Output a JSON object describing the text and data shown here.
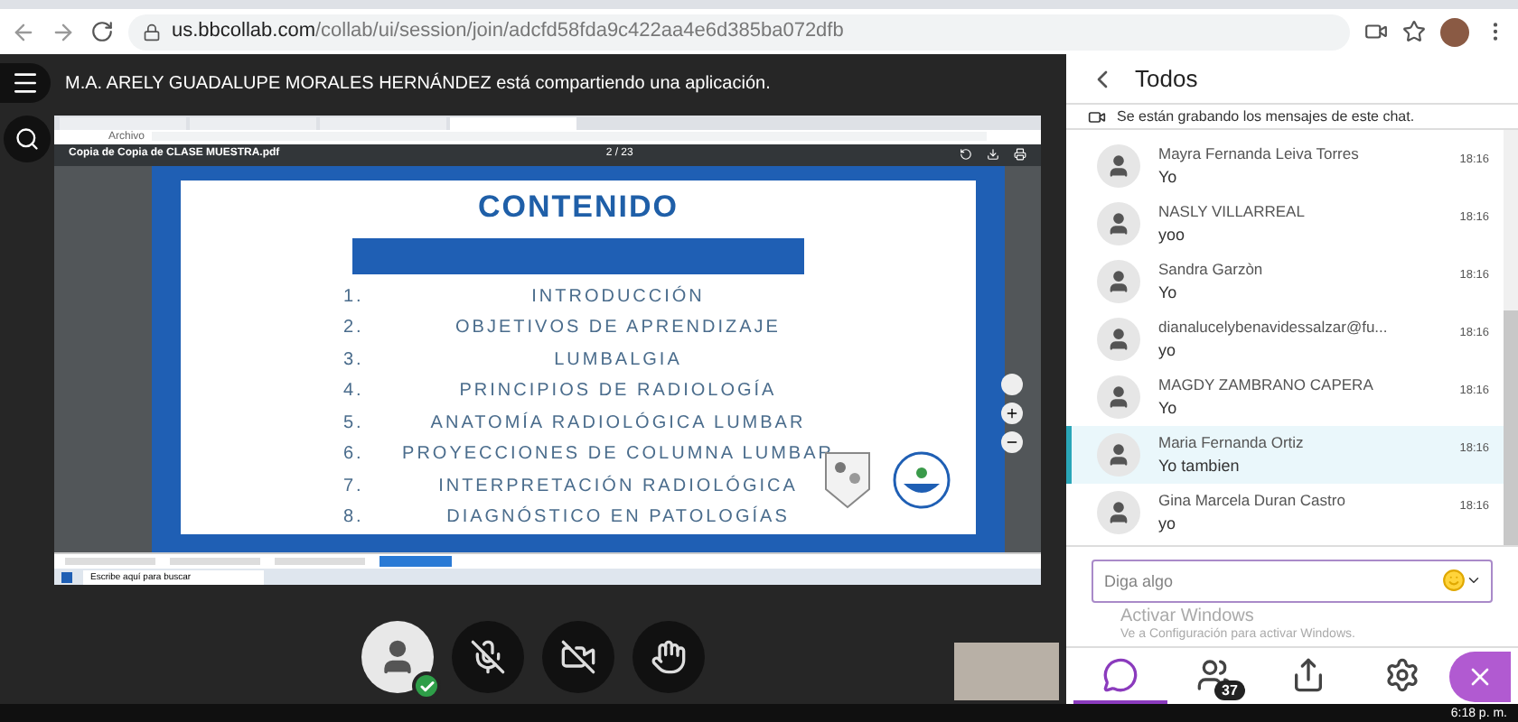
{
  "browser": {
    "url_host": "us.bbcollab.com",
    "url_path": "/collab/ui/session/join/adcfd58fda9c422aa4e6d385ba072dfb"
  },
  "share_banner": "M.A. ARELY GUADALUPE MORALES HERNÁNDEZ está compartiendo una aplicación.",
  "shared_screen": {
    "address_label": "Archivo",
    "pdf_title": "Copia de Copia de CLASE MUESTRA.pdf",
    "page_indicator": "2 / 23",
    "slide": {
      "title": "CONTENIDO",
      "items": [
        {
          "number": "1.",
          "label": "INTRODUCCIÓN"
        },
        {
          "number": "2.",
          "label": "OBJETIVOS DE APRENDIZAJE"
        },
        {
          "number": "3.",
          "label": "LUMBALGIA"
        },
        {
          "number": "4.",
          "label": "PRINCIPIOS DE RADIOLOGÍA"
        },
        {
          "number": "5.",
          "label": "ANATOMÍA RADIOLÓGICA LUMBAR"
        },
        {
          "number": "6.",
          "label": "PROYECCIONES DE COLUMNA LUMBAR"
        },
        {
          "number": "7.",
          "label": "INTERPRETACIÓN RADIOLÓGICA"
        },
        {
          "number": "8.",
          "label": "DIAGNÓSTICO EN PATOLOGÍAS"
        }
      ]
    },
    "taskbar_search": "Escribe aquí para buscar"
  },
  "session_controls": [
    {
      "kind": "avatar",
      "status": true
    },
    {
      "kind": "mic",
      "on": false
    },
    {
      "kind": "camera",
      "on": false
    },
    {
      "kind": "hand"
    }
  ],
  "chat": {
    "title": "Todos",
    "recording_notice": "Se están grabando los mensajes de este chat.",
    "messages": [
      {
        "name": "Mayra Fernanda Leiva Torres",
        "time": "18:16",
        "text": "Yo",
        "selected": false
      },
      {
        "name": "NASLY VILLARREAL",
        "time": "18:16",
        "text": "yoo",
        "selected": false
      },
      {
        "name": "Sandra Garzòn",
        "time": "18:16",
        "text": "Yo",
        "selected": false
      },
      {
        "name": "dianalucelybenavidessalzar@fu...",
        "time": "18:16",
        "text": "yo",
        "selected": false
      },
      {
        "name": "MAGDY ZAMBRANO CAPERA",
        "time": "18:16",
        "text": "Yo",
        "selected": false
      },
      {
        "name": "Maria Fernanda Ortiz",
        "time": "18:16",
        "text": "Yo tambien",
        "selected": true
      },
      {
        "name": "Gina Marcela Duran Castro",
        "time": "18:16",
        "text": "yo",
        "selected": false
      }
    ],
    "input": {
      "placeholder": "Diga algo"
    },
    "toolbar": [
      {
        "kind": "chat",
        "selected": true
      },
      {
        "kind": "people",
        "badge": "37",
        "selected": false
      },
      {
        "kind": "share",
        "selected": false
      },
      {
        "kind": "settings",
        "selected": false
      }
    ]
  },
  "activation_notice": {
    "title": "Activar Windows",
    "text": "Ve a Configuración para activar Windows."
  },
  "windows_taskbar": {
    "time": "6:18 p. m."
  }
}
